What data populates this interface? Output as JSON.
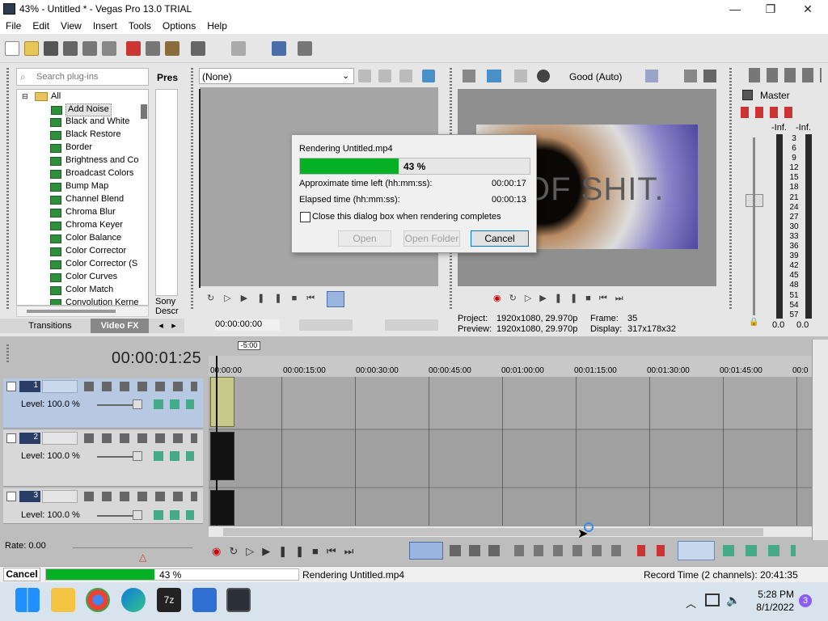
{
  "window": {
    "title": "43% - Untitled * - Vegas Pro 13.0 TRIAL",
    "minimize": "—",
    "maximize": "❐",
    "close": "✕"
  },
  "menu": [
    "File",
    "Edit",
    "View",
    "Insert",
    "Tools",
    "Options",
    "Help"
  ],
  "explorer": {
    "search_placeholder": "Search plug-ins",
    "presets_label": "Pres",
    "root": "All",
    "items": [
      "Add Noise",
      "Black and White",
      "Black Restore",
      "Border",
      "Brightness and Co",
      "Broadcast Colors",
      "Bump Map",
      "Channel Blend",
      "Chroma Blur",
      "Chroma Keyer",
      "Color Balance",
      "Color Corrector",
      "Color Corrector (S",
      "Color Curves",
      "Color Match",
      "Convolution Kerne"
    ],
    "sony_descr": "Sony\nDescr",
    "tabs": [
      "Transitions",
      "Video FX"
    ]
  },
  "trimmer": {
    "dropdown": "(None)",
    "time": "00:00:00:00"
  },
  "preview": {
    "quality": "Good (Auto)",
    "overlay_text": "OF SHIT.",
    "project_label": "Project:",
    "project_val": "1920x1080, 29.970p",
    "preview_label": "Preview:",
    "preview_val": "1920x1080, 29.970p",
    "frame_label": "Frame:",
    "frame_val": "35",
    "display_label": "Display:",
    "display_val": "317x178x32"
  },
  "mixer": {
    "title": "Master",
    "ticks": [
      "-Inf.",
      "-Inf.",
      "3",
      "6",
      "9",
      "12",
      "15",
      "18",
      "21",
      "24",
      "27",
      "30",
      "33",
      "36",
      "39",
      "42",
      "45",
      "48",
      "51",
      "54",
      "57"
    ],
    "left_val": "0.0",
    "right_val": "0.0"
  },
  "dialog": {
    "title": "Rendering Untitled.mp4",
    "progress_pct": 0.43,
    "progress_text": "43 %",
    "approx_label": "Approximate time left (hh:mm:ss):",
    "approx_val": "00:00:17",
    "elapsed_label": "Elapsed time (hh:mm:ss):",
    "elapsed_val": "00:00:13",
    "checkbox_label": "Close this dialog box when rendering completes",
    "open": "Open",
    "open_folder": "Open Folder",
    "cancel": "Cancel"
  },
  "timeline": {
    "timecode": "00:00:01:25",
    "marker": "-5:00",
    "ruler": [
      "00:00:00",
      "00:00:15:00",
      "00:00:30:00",
      "00:00:45:00",
      "00:01:00:00",
      "00:01:15:00",
      "00:01:30:00",
      "00:01:45:00",
      "00:0"
    ],
    "tracks": [
      {
        "num": "1",
        "level": "Level: 100.0 %"
      },
      {
        "num": "2",
        "level": "Level: 100.0 %"
      },
      {
        "num": "3",
        "level": "Level: 100.0 %"
      }
    ],
    "rate": "Rate: 0.00"
  },
  "status": {
    "cancel": "Cancel",
    "progress_pct": 0.43,
    "progress_text": "43 %",
    "message": "Rendering Untitled.mp4",
    "record_time": "Record Time (2 channels): 20:41:35"
  },
  "taskbar": {
    "time": "5:28 PM",
    "date": "8/1/2022",
    "badge": "3"
  },
  "colors": {
    "progress": "#06b025",
    "track_sel": "#b7c9e2",
    "trackhead": "#d8d8d8"
  }
}
